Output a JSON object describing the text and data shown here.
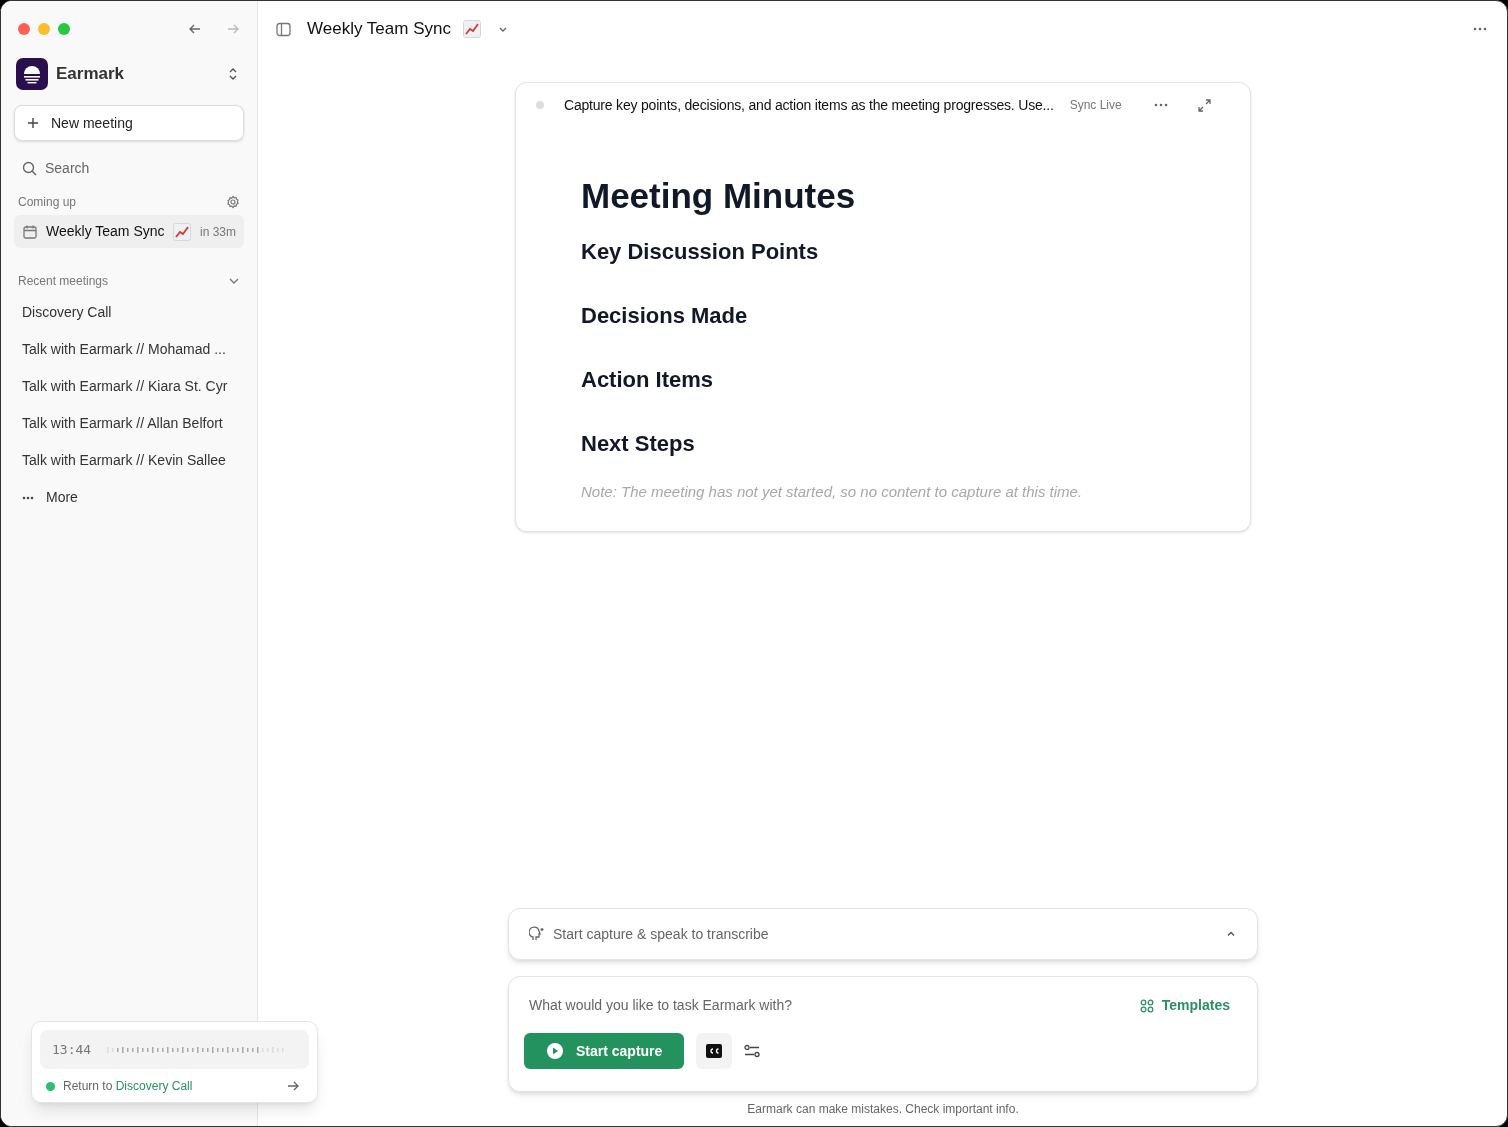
{
  "sidebar": {
    "app_name": "Earmark",
    "new_meeting": "New meeting",
    "search": {
      "placeholder": "Search"
    },
    "coming_up": {
      "label": "Coming up",
      "items": [
        {
          "title": "Weekly Team Sync",
          "when": "in 33m"
        }
      ]
    },
    "recent": {
      "label": "Recent meetings",
      "expanded": true,
      "items": [
        "Discovery Call",
        "Talk with Earmark // Mohamad ...",
        "Talk with Earmark // Kiara St. Cyr",
        "Talk with Earmark // Allan Belfort",
        "Talk with Earmark // Kevin Sallee"
      ],
      "more": "More"
    }
  },
  "header": {
    "title": "Weekly Team Sync"
  },
  "notes_card": {
    "instructions": "Capture key points, decisions, and action items as the meeting progresses. Use...",
    "sync": "Sync Live",
    "title": "Meeting Minutes",
    "sections": [
      "Key Discussion Points",
      "Decisions Made",
      "Action Items",
      "Next Steps"
    ],
    "note": "Note: The meeting has not yet started, so no content to capture at this time."
  },
  "transcript_bar": {
    "text": "Start capture & speak to transcribe",
    "expanded": false
  },
  "composer": {
    "placeholder": "What would you like to task Earmark with?",
    "templates": "Templates",
    "start": "Start capture"
  },
  "disclaimer": "Earmark can make mistakes. Check important info.",
  "recording_widget": {
    "time": "13:44",
    "return_prefix": "Return to",
    "return_link": "Discovery Call"
  }
}
